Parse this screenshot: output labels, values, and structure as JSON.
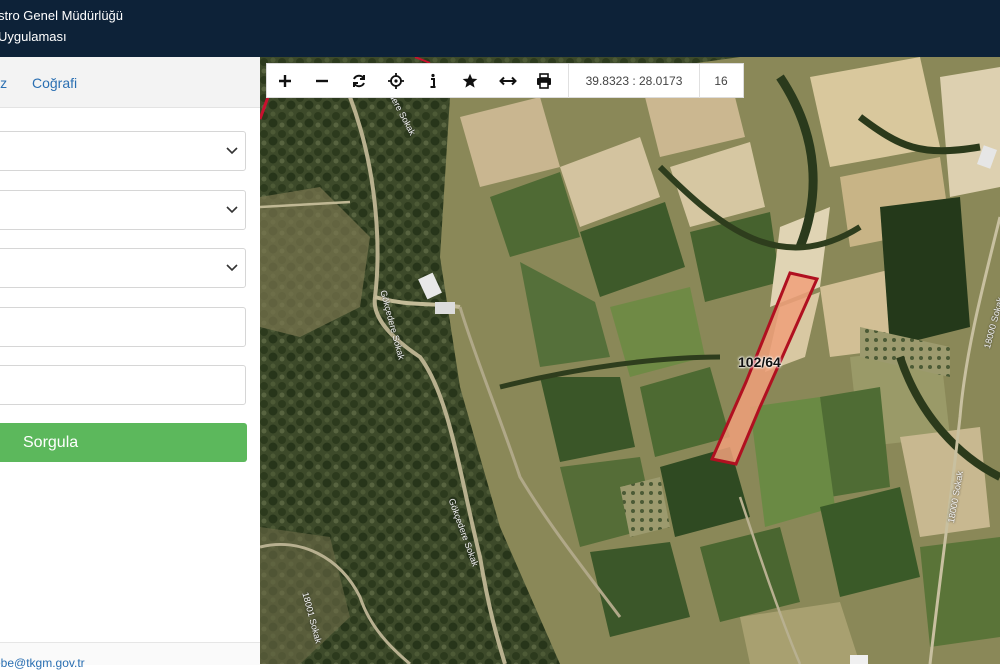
{
  "header": {
    "title_line1": "stro Genel Müdürlüğü",
    "title_line2": "Uygulaması"
  },
  "sidebar": {
    "tabs": [
      {
        "label": "iz"
      },
      {
        "label": "Coğrafi"
      }
    ],
    "query_button": "Sorgula",
    "footer_link": "ebe@tkgm.gov.tr"
  },
  "toolbar": {
    "tools": [
      "zoom-in-icon",
      "zoom-out-icon",
      "refresh-icon",
      "locate-icon",
      "info-icon",
      "favorite-icon",
      "measure-icon",
      "print-icon"
    ],
    "coordinates": "39.8323 : 28.0173",
    "zoom_level": "16"
  },
  "map": {
    "parcel_label": "102/64",
    "parcel_color": "#b01020",
    "parcel_fill": "#f0a07a",
    "road_labels": [
      "Gökçedere Sokak",
      "Gökçedere Sokak",
      "Gökçedere Sokak",
      "18000 Sokak",
      "18001 Sokak",
      "18000 Sokak"
    ]
  },
  "colors": {
    "header_bg": "#0d2238",
    "accent": "#2a6fb2",
    "button": "#5cb85c"
  }
}
